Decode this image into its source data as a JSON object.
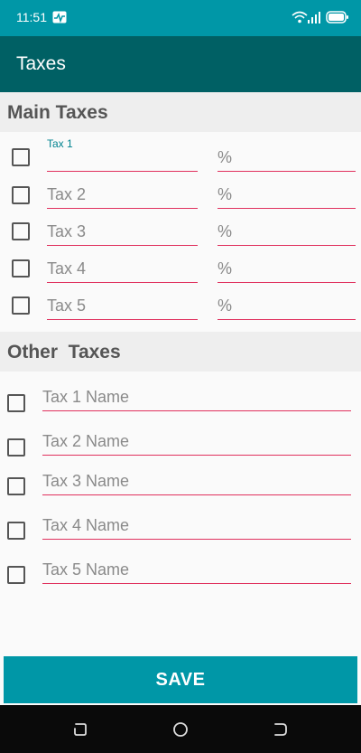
{
  "status_bar": {
    "time": "11:51"
  },
  "app_bar": {
    "title": "Taxes"
  },
  "main_taxes": {
    "header": "Main Taxes",
    "rows": [
      {
        "name_label": "Tax 1",
        "name_value": "",
        "percent_placeholder": "%"
      },
      {
        "name_placeholder": "Tax 2",
        "percent_placeholder": "%"
      },
      {
        "name_placeholder": "Tax 3",
        "percent_placeholder": "%"
      },
      {
        "name_placeholder": "Tax 4",
        "percent_placeholder": "%"
      },
      {
        "name_placeholder": "Tax 5",
        "percent_placeholder": "%"
      }
    ]
  },
  "other_taxes": {
    "header": "Other  Taxes",
    "rows": [
      {
        "name_placeholder": "Tax 1 Name"
      },
      {
        "name_placeholder": "Tax 2 Name"
      },
      {
        "name_placeholder": "Tax 3 Name"
      },
      {
        "name_placeholder": "Tax 4 Name"
      },
      {
        "name_placeholder": "Tax 5 Name"
      }
    ]
  },
  "actions": {
    "save_label": "SAVE"
  },
  "colors": {
    "status_bar": "#0097a7",
    "app_bar": "#006064",
    "accent_underline": "#e0315e",
    "floating_label": "#00838f",
    "save_button": "#0097a7"
  },
  "icons": [
    "activity-icon",
    "wifi-icon",
    "signal-icon",
    "battery-icon",
    "recent-apps-icon",
    "home-icon",
    "back-icon"
  ]
}
